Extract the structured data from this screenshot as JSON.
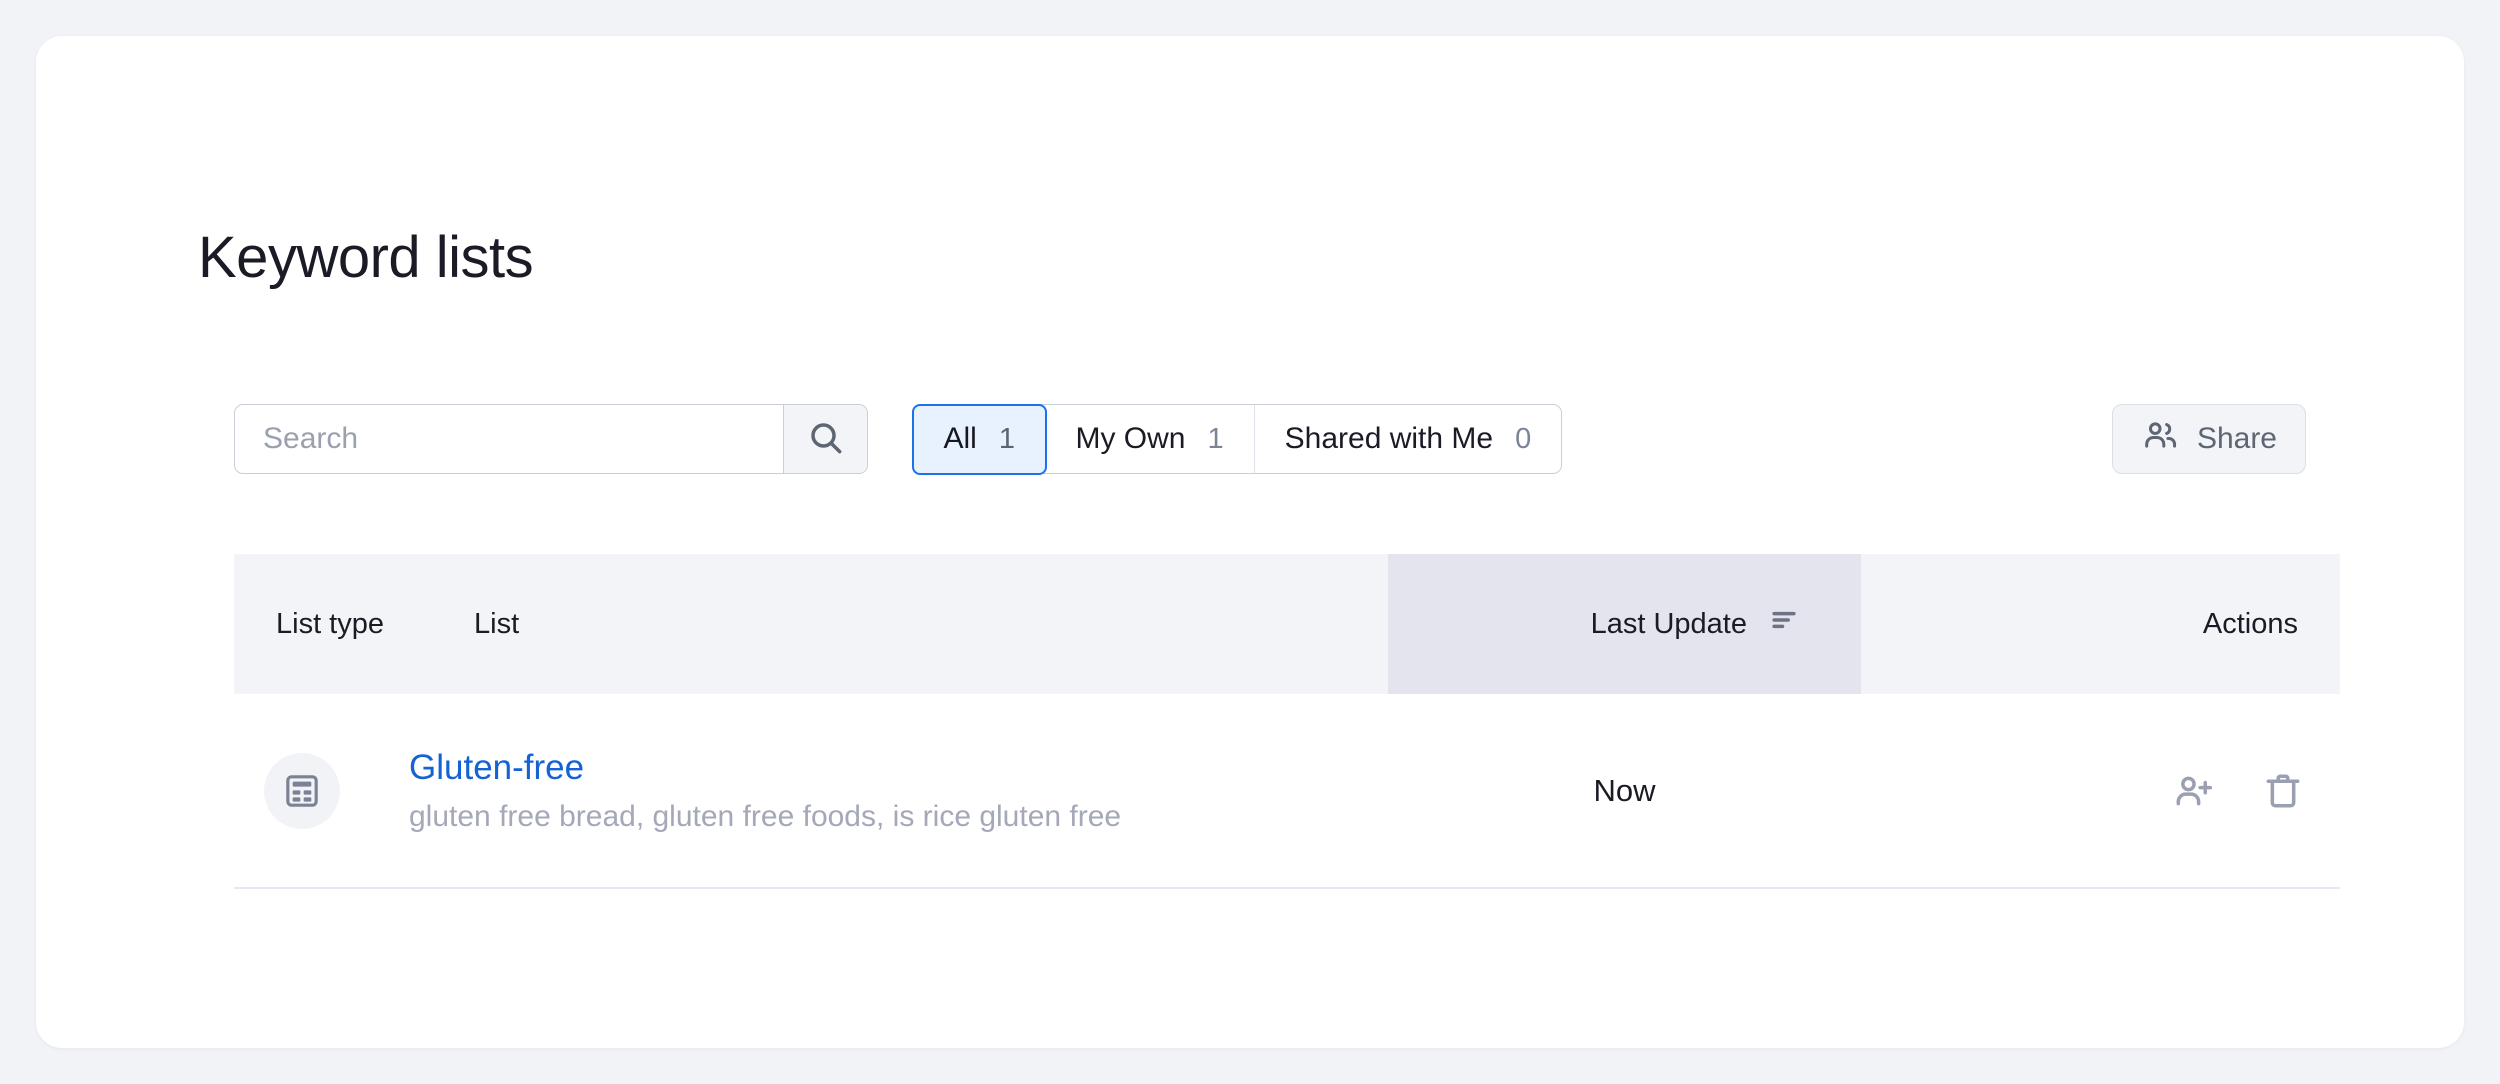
{
  "page": {
    "title": "Keyword lists",
    "background_color": "#f1f3f7",
    "card_color": "#ffffff"
  },
  "toolbar": {
    "search": {
      "placeholder": "Search",
      "value": "",
      "button_icon": "search-icon"
    },
    "tabs": [
      {
        "label": "All",
        "count": "1",
        "active": true
      },
      {
        "label": "My Own",
        "count": "1",
        "active": false
      },
      {
        "label": "Shared with Me",
        "count": "0",
        "active": false
      }
    ],
    "share": {
      "label": "Share",
      "icon": "people-icon"
    },
    "accent_color": "#1a73e8"
  },
  "table": {
    "columns": {
      "list_type": "List type",
      "list": "List",
      "last_update": "Last Update",
      "actions": "Actions"
    },
    "sort": {
      "column": "Last Update",
      "icon": "sort-descending-icon",
      "highlight_color": "#e3e4ed"
    },
    "rows": [
      {
        "type_icon": "table-list-icon",
        "name": "Gluten-free",
        "keywords": "gluten free bread, gluten free foods, is rice gluten free",
        "last_update": "Now",
        "actions": [
          {
            "name": "share-list",
            "icon": "person-add-icon"
          },
          {
            "name": "delete-list",
            "icon": "trash-icon"
          }
        ]
      }
    ]
  }
}
